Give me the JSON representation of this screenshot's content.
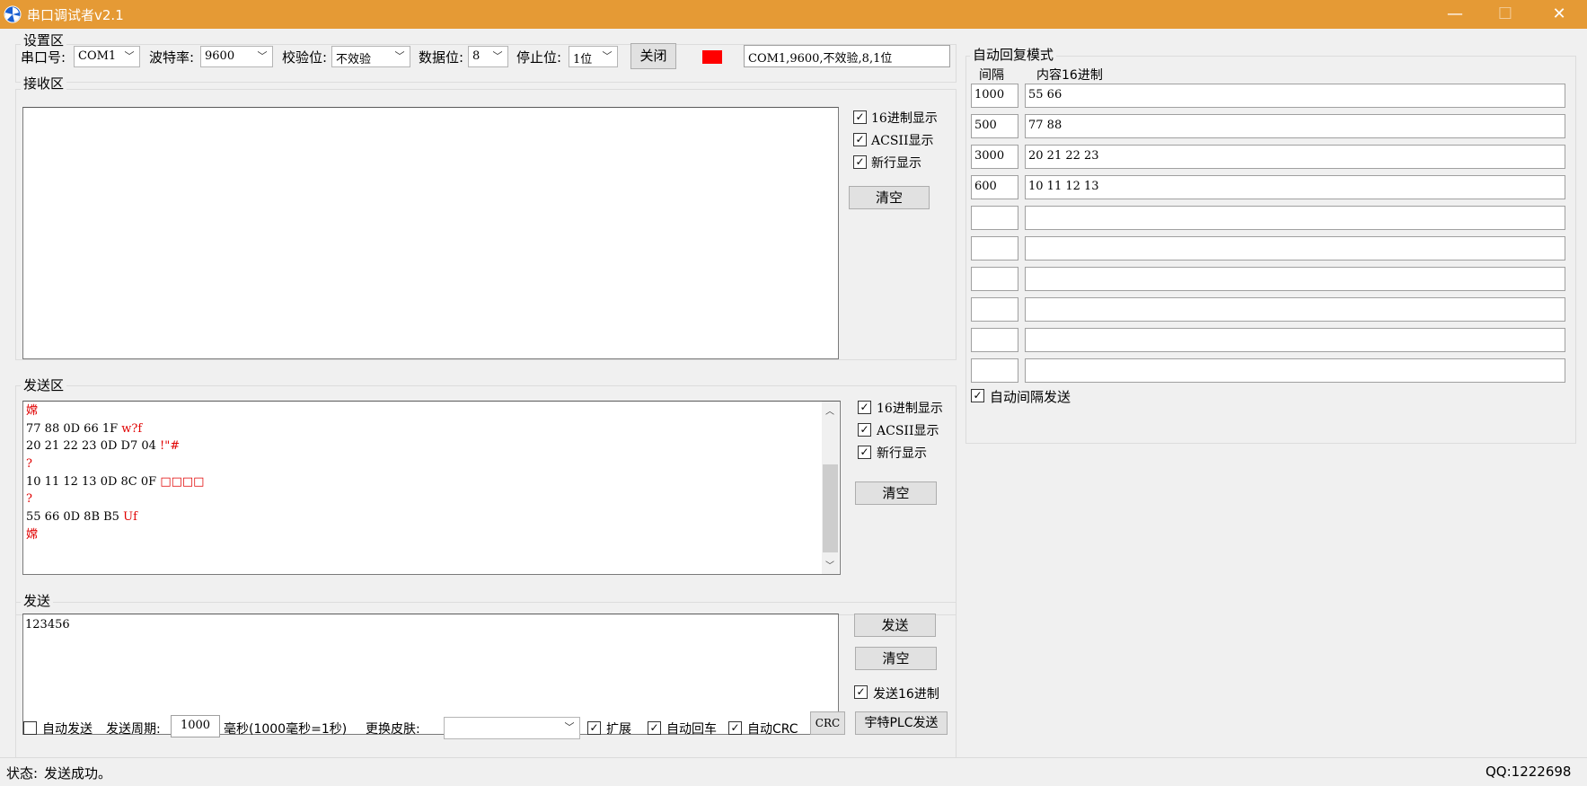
{
  "window": {
    "title": "串口调试者v2.1",
    "minimize": "—",
    "maximize": "☐",
    "close": "✕"
  },
  "settings": {
    "group_title": "设置区",
    "port_label": "串口号:",
    "port_value": "COM1",
    "baud_label": "波特率:",
    "baud_value": "9600",
    "parity_label": "校验位:",
    "parity_value": "不效验",
    "databits_label": "数据位:",
    "databits_value": "8",
    "stopbits_label": "停止位:",
    "stopbits_value": "1位",
    "close_button": "关闭",
    "status_color": "#ff0000",
    "status_text": "COM1,9600,不效验,8,1位"
  },
  "receive": {
    "group_title": "接收区",
    "hex_display": "16进制显示",
    "ascii_display": "ACSII显示",
    "newline_display": "新行显示",
    "clear_button": "清空"
  },
  "send_area": {
    "group_title": "发送区",
    "lines": [
      {
        "hex": "",
        "ascii": "嫦"
      },
      {
        "hex": "77 88 0D 66 1F",
        "ascii": "w?f"
      },
      {
        "hex": "20 21 22 23 0D D7 04",
        "ascii": " !\"#"
      },
      {
        "hex": "",
        "ascii": "?"
      },
      {
        "hex": "10 11 12 13 0D 8C 0F",
        "ascii": "□□□□"
      },
      {
        "hex": "",
        "ascii": "?"
      },
      {
        "hex": "55 66 0D 8B B5",
        "ascii": "Uf"
      },
      {
        "hex": "",
        "ascii": "嫦"
      }
    ],
    "hex_display": "16进制显示",
    "ascii_display": "ACSII显示",
    "newline_display": "新行显示",
    "clear_button": "清空"
  },
  "send": {
    "group_title": "发送",
    "content": "123456",
    "send_button": "发送",
    "clear_button": "清空",
    "send_hex": "发送16进制",
    "auto_send": "自动发送",
    "period_label": "发送周期:",
    "period_value": "1000",
    "period_unit": "毫秒(1000毫秒=1秒)",
    "skin_label": "更换皮肤:",
    "skin_value": "",
    "expand": "扩展",
    "auto_cr": "自动回车",
    "auto_crc": "自动CRC",
    "crc_button": "CRC",
    "plc_button": "宇特PLC发送"
  },
  "auto_reply": {
    "group_title": "自动回复模式",
    "interval_header": "间隔",
    "content_header": "内容16进制",
    "rows": [
      {
        "interval": "1000",
        "content": "55 66"
      },
      {
        "interval": "500",
        "content": "77 88"
      },
      {
        "interval": "3000",
        "content": "20 21 22 23"
      },
      {
        "interval": "600",
        "content": "10 11 12 13"
      },
      {
        "interval": "",
        "content": ""
      },
      {
        "interval": "",
        "content": ""
      },
      {
        "interval": "",
        "content": ""
      },
      {
        "interval": "",
        "content": ""
      },
      {
        "interval": "",
        "content": ""
      },
      {
        "interval": "",
        "content": ""
      }
    ],
    "auto_interval_send": "自动间隔发送"
  },
  "status": {
    "label": "状态:",
    "message": "发送成功。",
    "qq": "QQ:1222698"
  },
  "check_mark": "✓",
  "colors": {
    "titlebar": "#e59a35",
    "ascii_text": "#e00000",
    "status_indicator": "#ff0000"
  }
}
